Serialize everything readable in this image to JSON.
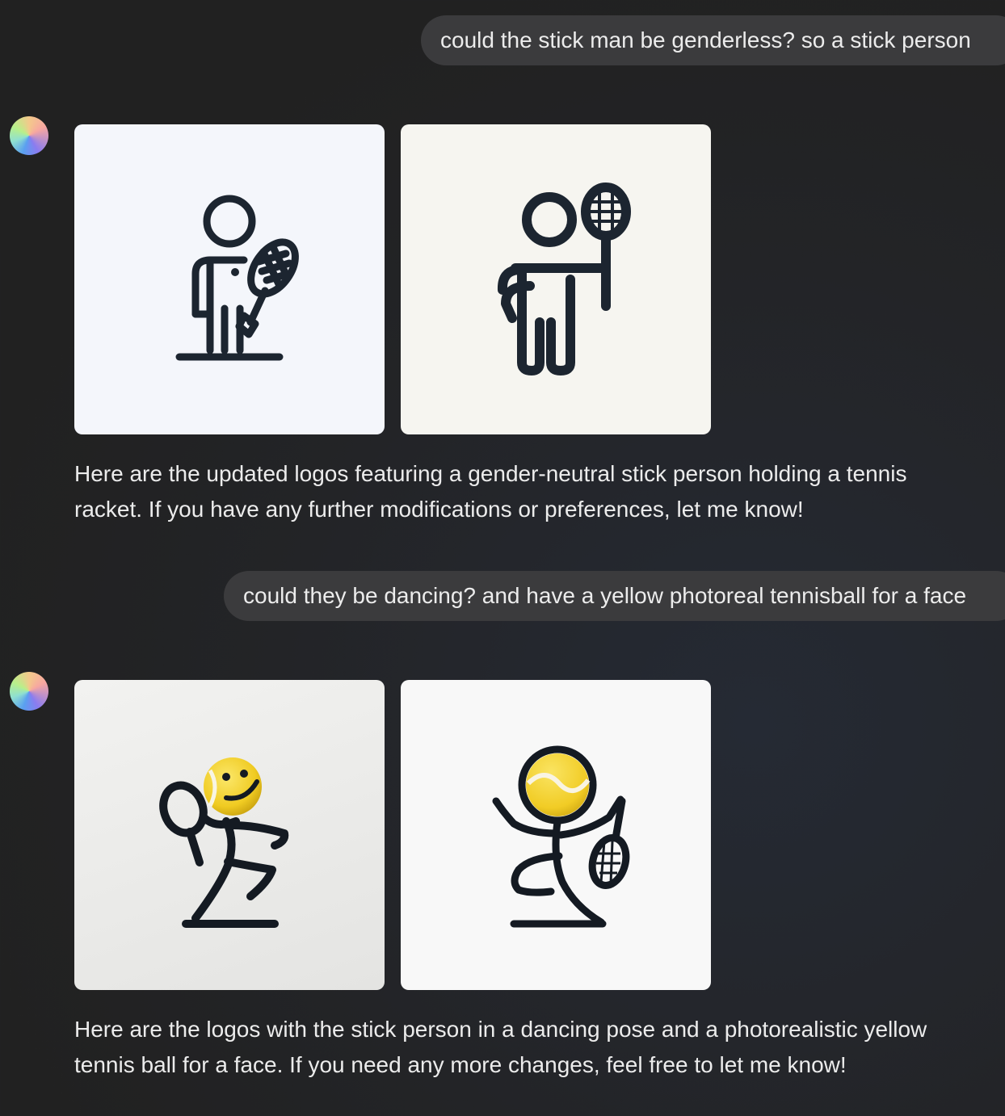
{
  "conversation": {
    "messages": [
      {
        "role": "user",
        "text": "could the stick man be genderless? so a stick person"
      },
      {
        "role": "assistant",
        "images": [
          {
            "icon": "stick-person-with-tennis-racket-icon"
          },
          {
            "icon": "stick-person-raising-tennis-racket-icon"
          }
        ],
        "text": "Here are the updated logos featuring a gender-neutral stick person holding a tennis racket. If you have any further modifications or preferences, let me know!"
      },
      {
        "role": "user",
        "text": "could they be dancing? and have a yellow photoreal tennisball for a face"
      },
      {
        "role": "assistant",
        "images": [
          {
            "icon": "dancing-stick-person-smiley-tennis-ball-icon"
          },
          {
            "icon": "dancing-stick-person-tennis-ball-head-icon"
          }
        ],
        "text": "Here are the logos with the stick person in a dancing pose and a photorealistic yellow tennis ball for a face. If you need any more changes, feel free to let me know!"
      }
    ]
  },
  "colors": {
    "background": "#212121",
    "user_bubble": "#3b3b3d",
    "text": "#ececec",
    "icon_stroke": "#1c2530",
    "tennis_ball": "#f2d22e"
  }
}
